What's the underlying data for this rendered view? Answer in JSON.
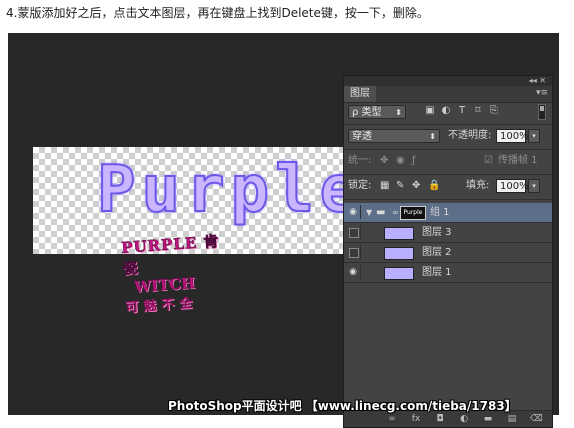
{
  "caption": "4.蒙版添加好之后，点击文本图层，再在键盘上找到Delete键，按一下，删除。",
  "canvas": {
    "text": "Purple"
  },
  "logo": {
    "line1": "PURPLE 肯瓷",
    "line2": "WITCH",
    "line3": "可魅不全"
  },
  "panel": {
    "top_controls": "◂◂ ✕",
    "tab_label": "图层",
    "tab_menu_icon": "menu-icon",
    "filter": {
      "label": "ρ 类型",
      "icons": [
        "image-filter-icon",
        "adjustment-filter-icon",
        "type-filter-icon",
        "shape-filter-icon",
        "smart-object-filter-icon"
      ]
    },
    "blend_mode": "穿透",
    "opacity_label": "不透明度:",
    "opacity_value": "100%",
    "unify_label": "统一:",
    "propagate_label": "传播帧 1",
    "lock_label": "锁定:",
    "fill_label": "填充:",
    "fill_value": "100%",
    "layers": [
      {
        "name": "组 1",
        "visible": true,
        "type": "group",
        "mask_text": "Purple",
        "selected": true
      },
      {
        "name": "图层 3",
        "visible": false,
        "type": "layer"
      },
      {
        "name": "图层 2",
        "visible": false,
        "type": "layer"
      },
      {
        "name": "图层 1",
        "visible": true,
        "type": "layer"
      }
    ],
    "bottom_icons": [
      "link-icon",
      "fx-icon",
      "mask-icon",
      "adjustment-icon",
      "folder-icon",
      "new-layer-icon",
      "trash-icon"
    ],
    "bottom_glyphs": [
      "∞",
      "fx",
      "◘",
      "◐",
      "▬",
      "▤",
      "🗑"
    ]
  },
  "watermark": "PhotoShop平面设计吧 【www.linecg.com/tieba/1783】"
}
